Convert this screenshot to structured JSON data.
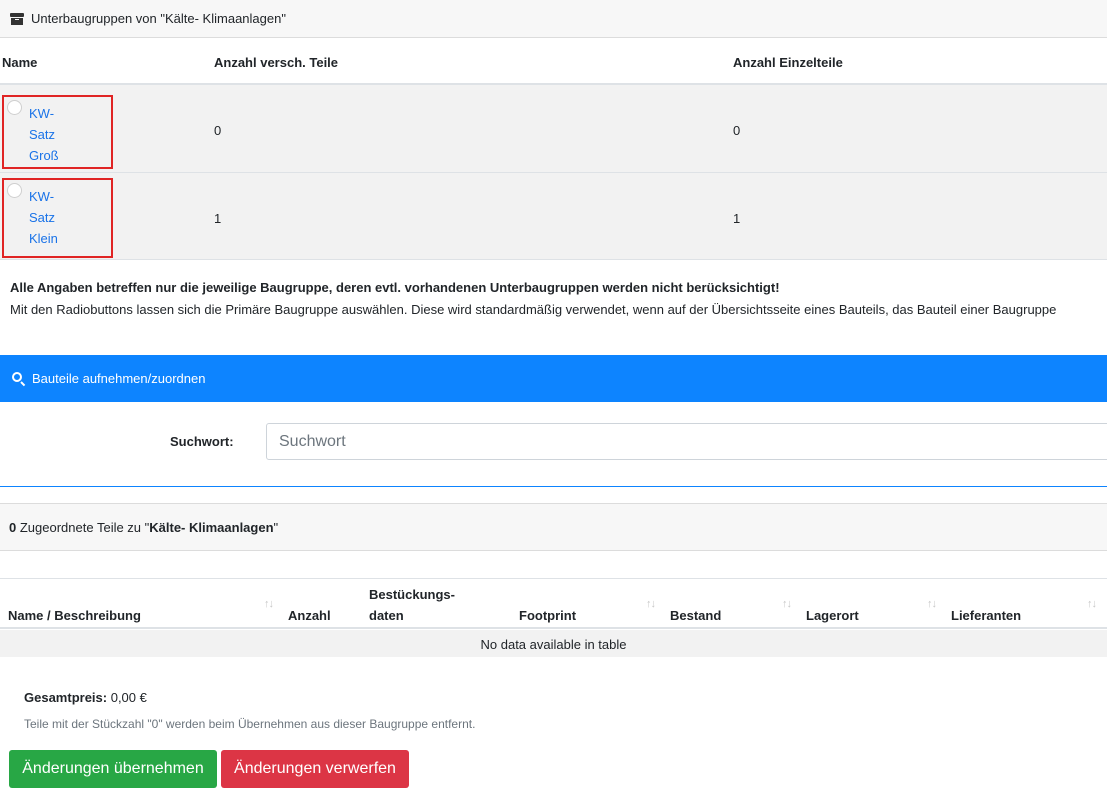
{
  "subgroups": {
    "title": "Unterbaugruppen von \"Kälte- Klimaanlagen\"",
    "columns": [
      "Name",
      "Anzahl versch. Teile",
      "Anzahl Einzelteile"
    ],
    "rows": [
      {
        "name_lines": [
          "KW-",
          "Satz",
          "Groß"
        ],
        "distinct_parts": "0",
        "single_parts": "0"
      },
      {
        "name_lines": [
          "KW-",
          "Satz",
          "Klein"
        ],
        "distinct_parts": "1",
        "single_parts": "1"
      }
    ],
    "note_bold": "Alle Angaben betreffen nur die jeweilige Baugruppe, deren evtl. vorhandenen Unterbaugruppen werden nicht berücksichtigt!",
    "note_text": "Mit den Radiobuttons lassen sich die Primäre Baugruppe auswählen. Diese wird standardmäßig verwendet, wenn auf der Übersichtsseite eines Bauteils, das Bauteil einer Baugruppe"
  },
  "search": {
    "panel_title": "Bauteile aufnehmen/zuordnen",
    "label": "Suchwort:",
    "placeholder": "Suchwort",
    "value": ""
  },
  "assigned": {
    "count": "0",
    "text_before": "Zugeordnete Teile zu \"",
    "group_name": "Kälte- Klimaanlagen",
    "text_after": "\"",
    "columns": [
      "Name / Beschreibung",
      "Anzahl",
      "Bestückungs-",
      "daten",
      "Footprint",
      "Bestand",
      "Lagerort",
      "Lieferanten"
    ],
    "empty_message": "No data available in table"
  },
  "totals": {
    "label": "Gesamtpreis:",
    "value": "0,00 €",
    "hint": "Teile mit der Stückzahl \"0\" werden beim Übernehmen aus dieser Baugruppe entfernt."
  },
  "buttons": {
    "apply": "Änderungen übernehmen",
    "discard": "Änderungen verwerfen"
  },
  "icons": {
    "panel_icon": "archive-box-icon",
    "search_icon": "search-icon",
    "sort_icon": "sort-arrows-icon"
  },
  "colors": {
    "primary_blue": "#0d84ff",
    "link_blue": "#1a73e8",
    "success_green": "#28a745",
    "danger_red": "#dc3545",
    "highlight_red": "#e02424"
  }
}
